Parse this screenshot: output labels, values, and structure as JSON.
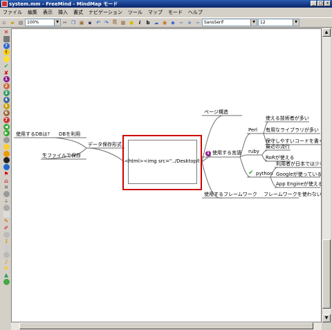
{
  "window": {
    "title": "system.mm - FreeMind - MindMap モード"
  },
  "menu": [
    "ファイル",
    "編集",
    "表示",
    "挿入",
    "書式",
    "ナビゲーション",
    "ツール",
    "マップ",
    "モード",
    "ヘルプ"
  ],
  "toolbar": {
    "zoom": "100%",
    "font": "SansSerif",
    "size": "12"
  },
  "colors": {
    "selection_border": "#cc0000",
    "link_line": "#6b6b6b"
  },
  "nodes": {
    "center": "<html><img src=\"../Desktop/blan",
    "page_structure": "ページ構造",
    "data_format": "データ保存形式",
    "use_db": "DBを利用",
    "db_question": "使用するDBは?",
    "save_file": "生ファイルで保存",
    "languages": "使用する言語",
    "perl": "Perl",
    "perl_1": "使える技術者が多い",
    "perl_2": "有用なライブラリが多い",
    "perl_3": "保守しやすいコードを書くの",
    "ruby": "ruby",
    "ruby_1": "最近の流行",
    "ruby_2": "RoRが使える",
    "python": "python",
    "python_1": "利用者が日本では少な",
    "python_2": "Googleが使っている",
    "python_3": "App Engineが使える",
    "framework": "使用するフレームワーク",
    "framework_q": "フレームワークを使わない?",
    "lang_badge": "1"
  }
}
